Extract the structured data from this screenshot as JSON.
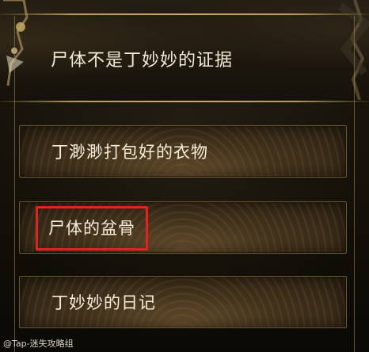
{
  "question": {
    "text": "尸体不是丁妙妙的证据"
  },
  "options": [
    {
      "label": "丁渺渺打包好的衣物"
    },
    {
      "label": "尸体的盆骨"
    },
    {
      "label": "丁妙妙的日记"
    }
  ],
  "highlighted_option": "尸体的盆骨",
  "watermark": {
    "text": "@Tap-迷失攻略组"
  },
  "colors": {
    "highlight_border": "#e3231f",
    "text": "#f3ead6",
    "gold_line": "#c8ab6e"
  }
}
